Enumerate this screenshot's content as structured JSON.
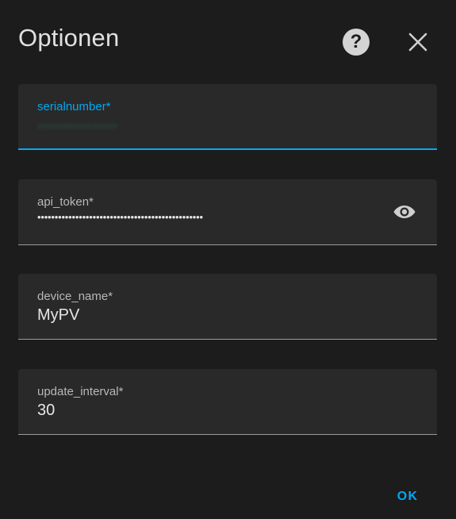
{
  "dialog": {
    "title": "Optionen",
    "help_icon": "help-circle-icon",
    "close_icon": "close-icon"
  },
  "fields": {
    "serialnumber": {
      "label": "serialnumber*",
      "value": "••••••••••••••••",
      "focused": true
    },
    "api_token": {
      "label": "api_token*",
      "value": "••••••••••••••••••••••••••••••••••••••••••••••••",
      "toggle_icon": "eye-icon"
    },
    "device_name": {
      "label": "device_name*",
      "value": "MyPV"
    },
    "update_interval": {
      "label": "update_interval*",
      "value": "30"
    }
  },
  "actions": {
    "ok_label": "OK"
  },
  "colors": {
    "accent": "#03a9f4",
    "background": "#1c1c1c",
    "field_background": "#292929"
  }
}
